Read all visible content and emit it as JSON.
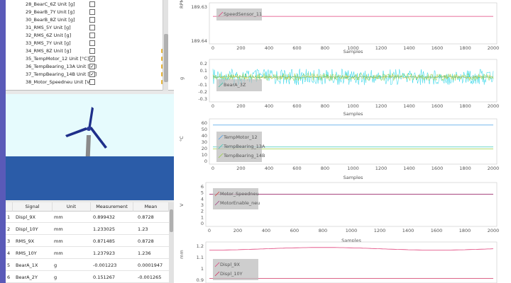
{
  "channels": [
    {
      "label": "28_BearC_6Z Unit [g]",
      "checked": false,
      "folder": false
    },
    {
      "label": "29_BearB_7Y Unit [g]",
      "checked": false,
      "folder": false
    },
    {
      "label": "30_BearB_8Z Unit [g]",
      "checked": false,
      "folder": false
    },
    {
      "label": "31_RMS_5Y Unit [g]",
      "checked": false,
      "folder": false
    },
    {
      "label": "32_RMS_6Z Unit [g]",
      "checked": false,
      "folder": false
    },
    {
      "label": "33_RMS_7Y Unit [g]",
      "checked": false,
      "folder": false
    },
    {
      "label": "34_RMS_8Z Unit [g]",
      "checked": false,
      "folder": true
    },
    {
      "label": "35_TempMotor_12 Unit [°C]",
      "checked": true,
      "folder": true
    },
    {
      "label": "36_TempBearing_13A Unit [°C]",
      "checked": true,
      "folder": true
    },
    {
      "label": "37_TempBearing_14B Unit [°C]",
      "checked": true,
      "folder": true
    },
    {
      "label": "38_Motor_Speedneu Unit [V]",
      "checked": false,
      "folder": true
    }
  ],
  "check_mark": "✓",
  "table": {
    "headers": [
      "Signal",
      "Unit",
      "Measurement",
      "Mean"
    ],
    "rows": [
      {
        "n": "1",
        "signal": "Displ_9X",
        "unit": "mm",
        "meas": "0.899432",
        "mean": "0.8728"
      },
      {
        "n": "2",
        "signal": "Displ_10Y",
        "unit": "mm",
        "meas": "1.233025",
        "mean": "1.23"
      },
      {
        "n": "3",
        "signal": "RMS_9X",
        "unit": "mm",
        "meas": "0.871485",
        "mean": "0.8728"
      },
      {
        "n": "4",
        "signal": "RMS_10Y",
        "unit": "mm",
        "meas": "1.237923",
        "mean": "1.236"
      },
      {
        "n": "5",
        "signal": "BearA_1X",
        "unit": "g",
        "meas": "-0.001223",
        "mean": "0.0001947"
      },
      {
        "n": "6",
        "signal": "BearA_2Y",
        "unit": "g",
        "meas": "0.151267",
        "mean": "-0.001265"
      }
    ]
  },
  "chart_data": [
    {
      "type": "line",
      "ylabel": "RPM",
      "xlabel": "Samples",
      "xlim": [
        0,
        2000
      ],
      "xticks": [
        0,
        200,
        400,
        600,
        800,
        1000,
        1200,
        1400,
        1600,
        1800,
        2000
      ],
      "yticks": [
        "189.63",
        "189.64"
      ],
      "series": [
        {
          "name": "SpeedSensor_11",
          "color": "#e0407a",
          "values": [
            189.632
          ]
        }
      ]
    },
    {
      "type": "line",
      "ylabel": "g",
      "xlabel": "Samples",
      "xlim": [
        0,
        2000
      ],
      "xticks": [
        0,
        200,
        400,
        600,
        800,
        1000,
        1200,
        1400,
        1600,
        1800,
        2000
      ],
      "yticks": [
        "0.2",
        "0.1",
        "0",
        "-0.1",
        "-0.2",
        "-0.3"
      ],
      "ylim": [
        -0.3,
        0.2
      ],
      "series": [
        {
          "name": "",
          "color": "#22d4e8",
          "amplitude": 0.11
        },
        {
          "name": "",
          "color": "#8fd23a",
          "amplitude": 0.05
        },
        {
          "name": "",
          "color": "#e8c020",
          "amplitude": 0.02
        },
        {
          "name": "BearA_3Z",
          "color": "#3ab8a0",
          "amplitude": 0.01
        }
      ]
    },
    {
      "type": "line",
      "ylabel": "°C",
      "xlabel": "Samples",
      "xlim": [
        0,
        2000
      ],
      "xticks": [
        0,
        200,
        400,
        600,
        800,
        1000,
        1200,
        1400,
        1600,
        1800,
        2000
      ],
      "yticks": [
        "60",
        "50",
        "40",
        "30",
        "20",
        "10",
        "0"
      ],
      "ylim": [
        0,
        65
      ],
      "series": [
        {
          "name": "TempMotor_12",
          "color": "#4aa0e8",
          "values": [
            59.5
          ]
        },
        {
          "name": "TempBearing_13A",
          "color": "#3ac8b8",
          "values": [
            23.5
          ]
        },
        {
          "name": "TempBearing_14B",
          "color": "#9ad040",
          "values": [
            20.5
          ]
        }
      ]
    },
    {
      "type": "line",
      "ylabel": "V",
      "xlabel": "Samples",
      "xlim": [
        0,
        2000
      ],
      "xticks": [
        0,
        200,
        400,
        600,
        800,
        1000,
        1200,
        1400,
        1600,
        1800,
        2000
      ],
      "yticks": [
        "6",
        "5",
        "4",
        "3",
        "2",
        "1",
        "0"
      ],
      "ylim": [
        0,
        6.5
      ],
      "series": [
        {
          "name": "Motor_Speedneu",
          "color": "#d04040",
          "values": [
            5.0
          ]
        },
        {
          "name": "MotorEnable_neu",
          "color": "#a04080",
          "values": [
            5.0
          ]
        }
      ]
    },
    {
      "type": "line",
      "ylabel": "mm",
      "xlabel": "",
      "xlim": [
        0,
        2000
      ],
      "yticks": [
        "1.2",
        "1.1",
        "1",
        "0.9"
      ],
      "ylim": [
        0.88,
        1.28
      ],
      "series": [
        {
          "name": "Displ_9X",
          "color": "#e0407a",
          "values": [
            1.2,
            1.25,
            1.22
          ]
        },
        {
          "name": "Displ_10Y",
          "color": "#d03060",
          "values": [
            0.9
          ]
        }
      ]
    }
  ]
}
